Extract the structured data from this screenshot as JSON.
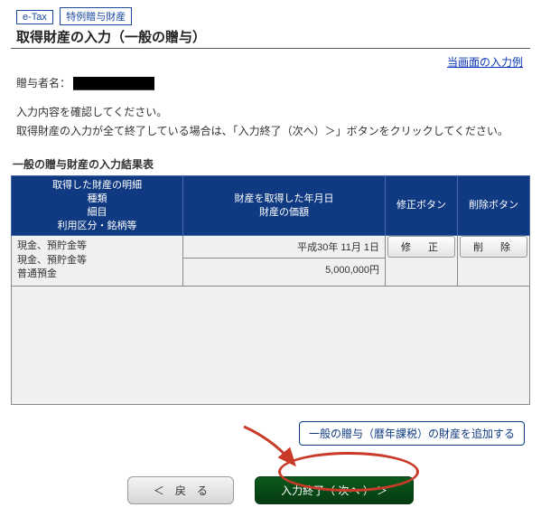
{
  "badges": {
    "etax": "e-Tax",
    "special": "特例贈与財産"
  },
  "title": "取得財産の入力（一般の贈与）",
  "example_link": "当画面の入力例",
  "donor_label": "贈与者名：",
  "instructions": {
    "line1": "入力内容を確認してください。",
    "line2": "取得財産の入力が全て終了している場合は、「入力終了（次へ）＞」ボタンをクリックしてください。"
  },
  "section_title": "一般の贈与財産の入力結果表",
  "table": {
    "head": {
      "col1": "取得した財産の明細\n種類\n細目\n利用区分・銘柄等",
      "col2": "財産を取得した年月日\n財産の価額",
      "col3": "修正ボタン",
      "col4": "削除ボタン"
    },
    "rows": [
      {
        "detail_lines": [
          "現金、預貯金等",
          "現金、預貯金等",
          "普通預金"
        ],
        "date": "平成30年 11月 1日",
        "value": "5,000,000円",
        "edit": "修　正",
        "delete": "削　除"
      }
    ]
  },
  "add_button": "一般の贈与（暦年課税）の財産を追加する",
  "nav": {
    "back": "＜　戻　る",
    "next": "入力終了（ 次へ ） ＞"
  }
}
